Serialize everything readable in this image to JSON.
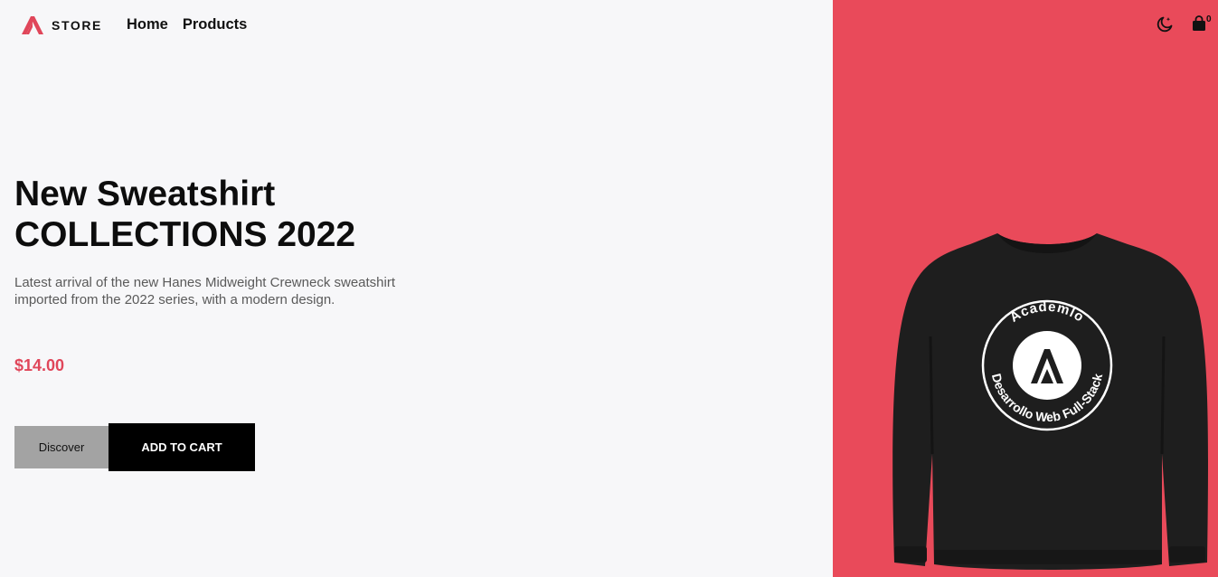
{
  "brand": {
    "name": "STORE",
    "logo_icon": "academlo-a-logo",
    "accent": "#e0465a"
  },
  "nav": {
    "items": [
      "Home",
      "Products"
    ]
  },
  "actions": {
    "theme_icon": "moon-star-icon",
    "cart_icon": "shopping-bag-icon",
    "cart_count": "0"
  },
  "hero": {
    "title_line1": "New Sweatshirt",
    "title_line2": "COLLECTIONS 2022",
    "description": "Latest arrival of the new Hanes Midweight Crewneck sweatshirt imported from the 2022 series, with a modern design.",
    "price": "$14.00",
    "discover_label": "Discover",
    "add_to_cart_label": "ADD TO CART"
  },
  "product_image": {
    "print_top": "Academlo",
    "print_bottom": "Desarrollo Web Full-Stack",
    "panel_color": "#e94a5a",
    "garment_color": "#1e1e1e"
  }
}
